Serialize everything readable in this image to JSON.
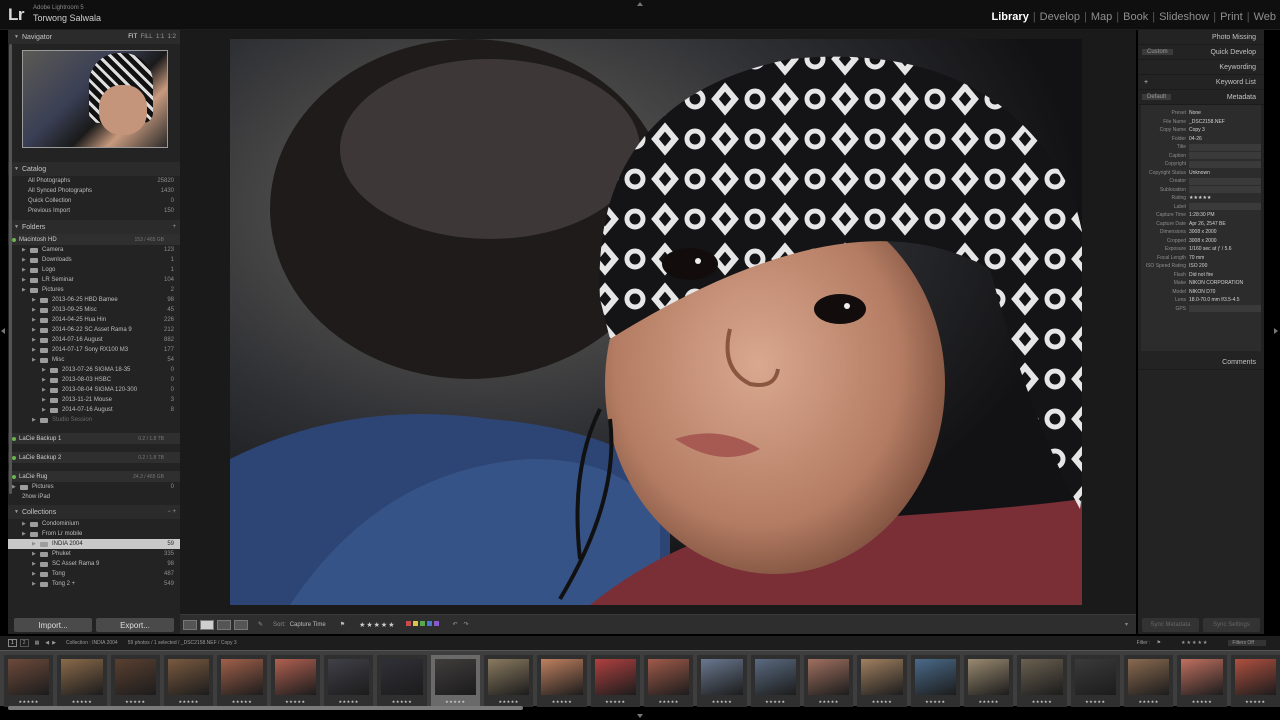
{
  "app": {
    "logo": "Lr",
    "app_name": "Adobe Lightroom 5",
    "user_name": "Torwong Salwala"
  },
  "modules": [
    {
      "label": "Library",
      "active": true
    },
    {
      "label": "Develop",
      "active": false
    },
    {
      "label": "Map",
      "active": false
    },
    {
      "label": "Book",
      "active": false
    },
    {
      "label": "Slideshow",
      "active": false
    },
    {
      "label": "Print",
      "active": false
    },
    {
      "label": "Web",
      "active": false
    }
  ],
  "navigator": {
    "title": "Navigator",
    "zoom_options": [
      "FIT",
      "FILL",
      "1:1",
      "1:2"
    ]
  },
  "catalog": {
    "title": "Catalog",
    "items": [
      {
        "label": "All Photographs",
        "count": "25820",
        "selected": false
      },
      {
        "label": "All Synced Photographs",
        "count": "1430",
        "selected": false
      },
      {
        "label": "Quick Collection",
        "count": "0",
        "selected": false
      },
      {
        "label": "Previous Import",
        "count": "150",
        "selected": false
      }
    ]
  },
  "folders": {
    "title": "Folders",
    "volume": {
      "label": "Macintosh HD",
      "capacity": "153 / 465 GB"
    },
    "items": [
      {
        "label": "Camera",
        "count": "123",
        "indent": 1
      },
      {
        "label": "Downloads",
        "count": "1",
        "indent": 1
      },
      {
        "label": "Logo",
        "count": "1",
        "indent": 1
      },
      {
        "label": "LR Seminar",
        "count": "104",
        "indent": 1
      },
      {
        "label": "Pictures",
        "count": "2",
        "indent": 1
      },
      {
        "label": "2013-06-25 HBD Bamee",
        "count": "98",
        "indent": 2
      },
      {
        "label": "2013-09-25 Misc",
        "count": "45",
        "indent": 2
      },
      {
        "label": "2014-04-25 Hua Hin",
        "count": "226",
        "indent": 2
      },
      {
        "label": "2014-06-22 SC Asset Rama 9",
        "count": "212",
        "indent": 2
      },
      {
        "label": "2014-07-16 August",
        "count": "882",
        "indent": 2
      },
      {
        "label": "2014-07-17 Sony RX100 M3",
        "count": "177",
        "indent": 2
      },
      {
        "label": "Misc",
        "count": "54",
        "indent": 2
      },
      {
        "label": "2013-07-26 SIGMA 18-35",
        "count": "0",
        "indent": 3
      },
      {
        "label": "2013-08-03 HSBC",
        "count": "0",
        "indent": 3
      },
      {
        "label": "2013-08-04 SIGMA 120-300",
        "count": "0",
        "indent": 3
      },
      {
        "label": "2013-11-21 Mouse",
        "count": "3",
        "indent": 3
      },
      {
        "label": "2014-07-16 August",
        "count": "8",
        "indent": 3
      },
      {
        "label": "Studio Session",
        "count": "",
        "indent": 2,
        "dim": true
      }
    ],
    "other_volumes": [
      {
        "label": "LaCie Backup 1",
        "capacity": "0.2 / 1.8 TB"
      },
      {
        "label": "LaCie Backup 2",
        "capacity": "0.2 / 1.8 TB"
      },
      {
        "label": "LaCie Rug",
        "capacity": "24.3 / 465 GB"
      }
    ],
    "lacie_rug_items": [
      {
        "label": "Pictures",
        "count": "0"
      }
    ],
    "extra": "2how iPad"
  },
  "collections": {
    "title": "Collections",
    "items": [
      {
        "label": "Condominium",
        "count": "",
        "indent": 1,
        "selected": false
      },
      {
        "label": "From Lr mobile",
        "count": "",
        "indent": 1,
        "selected": false
      },
      {
        "label": "INDIA 2004",
        "count": "59",
        "indent": 2,
        "selected": true
      },
      {
        "label": "Phuket",
        "count": "335",
        "indent": 2,
        "selected": false
      },
      {
        "label": "SC Asset Rama 9",
        "count": "98",
        "indent": 2,
        "selected": false
      },
      {
        "label": "Tong",
        "count": "487",
        "indent": 2,
        "selected": false
      },
      {
        "label": "Tong 2 +",
        "count": "549",
        "indent": 2,
        "selected": false
      }
    ]
  },
  "left_footer": {
    "import": "Import...",
    "export": "Export..."
  },
  "toolbar": {
    "sort_label": "Sort:",
    "sort_value": "Capture Time",
    "stars": "★★★★★"
  },
  "right_panel": {
    "photo_missing": "Photo Missing",
    "quick_develop": "Quick Develop",
    "quick_develop_preset": "Custom",
    "keywording": "Keywording",
    "keyword_list": "Keyword List",
    "metadata": "Metadata",
    "metadata_preset": "Default",
    "comments": "Comments",
    "fields": [
      {
        "k": "Preset",
        "v": "None"
      },
      {
        "k": "File Name",
        "v": "_DSC2158.NEF"
      },
      {
        "k": "Copy Name",
        "v": "Copy 3"
      },
      {
        "k": "Folder",
        "v": "04-26"
      },
      {
        "k": "Title",
        "v": ""
      },
      {
        "k": "Caption",
        "v": ""
      },
      {
        "k": "Copyright",
        "v": ""
      },
      {
        "k": "Copyright Status",
        "v": "Unknown"
      },
      {
        "k": "Creator",
        "v": ""
      },
      {
        "k": "Sublocation",
        "v": ""
      },
      {
        "k": "Rating",
        "v": "★★★★★"
      },
      {
        "k": "Label",
        "v": ""
      },
      {
        "k": "Capture Time",
        "v": "1:28:30 PM"
      },
      {
        "k": "Capture Date",
        "v": "Apr 26, 2547 BE"
      },
      {
        "k": "Dimensions",
        "v": "3008 x 2000"
      },
      {
        "k": "Cropped",
        "v": "3008 x 2000"
      },
      {
        "k": "Exposure",
        "v": "1/160 sec at ƒ / 5.6"
      },
      {
        "k": "Focal Length",
        "v": "70 mm"
      },
      {
        "k": "ISO Speed Rating",
        "v": "ISO 200"
      },
      {
        "k": "Flash",
        "v": "Did not fire"
      },
      {
        "k": "Make",
        "v": "NIKON CORPORATION"
      },
      {
        "k": "Model",
        "v": "NIKON D70"
      },
      {
        "k": "Lens",
        "v": "18.0-70.0 mm f/3.5-4.5"
      },
      {
        "k": "GPS",
        "v": ""
      }
    ],
    "sync_metadata": "Sync Metadata",
    "sync_settings": "Sync Settings"
  },
  "filterbar": {
    "source": "Collection : INDIA 2004",
    "count_text": "59 photos / 1 selected / _DSC2158.NEF / Copy 3",
    "filter_label": "Filter :",
    "filter_value": "Filters Off"
  },
  "filmstrip": {
    "thumb_stars": "★★★★★",
    "selected_index": 8
  },
  "colors": {
    "accent": "#ffffff",
    "panel_bg": "#232323",
    "center_bg": "#1a1a1a"
  }
}
